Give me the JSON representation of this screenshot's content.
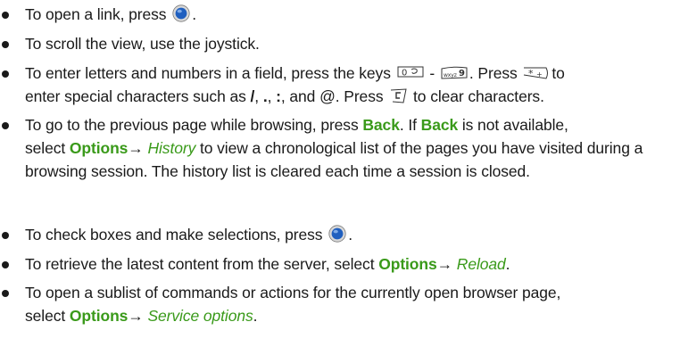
{
  "bullets": {
    "b1": {
      "t1": "To open a link, press",
      "t2": "."
    },
    "b2": {
      "t1": "To scroll the view, use the joystick."
    },
    "b3": {
      "t1": "To enter letters and numbers in a field, press the keys",
      "t2": "-",
      "t3": ". Press",
      "t4": "to",
      "t5": "enter special characters such as",
      "s1": "/",
      "c1": ",",
      "s2": ".",
      "c2": ",",
      "s3": ":",
      "c3": ", and",
      "s4": "@",
      "t6": ". Press",
      "t7": "to clear characters."
    },
    "b4": {
      "t1": "To go to the previous page while browsing, press",
      "u1": "Back",
      "t2": ". If",
      "u2": "Back",
      "t3": "is not available,",
      "t4": "select",
      "u3": "Options",
      "arrow": "→",
      "i1": "History",
      "t5": "to view a chronological list of the pages you have visited during a browsing session. The history list is cleared each time a session is closed."
    },
    "b5": {
      "t1": "To check boxes and make selections, press",
      "t2": "."
    },
    "b6": {
      "t1": "To retrieve the latest content from the server, select",
      "u1": "Options",
      "arrow": "→",
      "i1": "Reload",
      "t2": "."
    },
    "b7": {
      "t1": "To open a sublist of commands or actions for the currently open browser page,",
      "t2": "select",
      "u1": "Options",
      "arrow": "→",
      "i1": "Service options",
      "t3": "."
    }
  },
  "icons": {
    "joystick_button": "joystick-center-icon",
    "key_zero": "key-0-space-icon",
    "key_nine": "key-9-wxyz-icon",
    "key_star": "key-star-icon",
    "key_clear": "key-clear-c-icon"
  },
  "colors": {
    "ui_text": "#3a9a1a",
    "body_text": "#1a1a1a",
    "joystick_blue": "#1f5fbf"
  }
}
